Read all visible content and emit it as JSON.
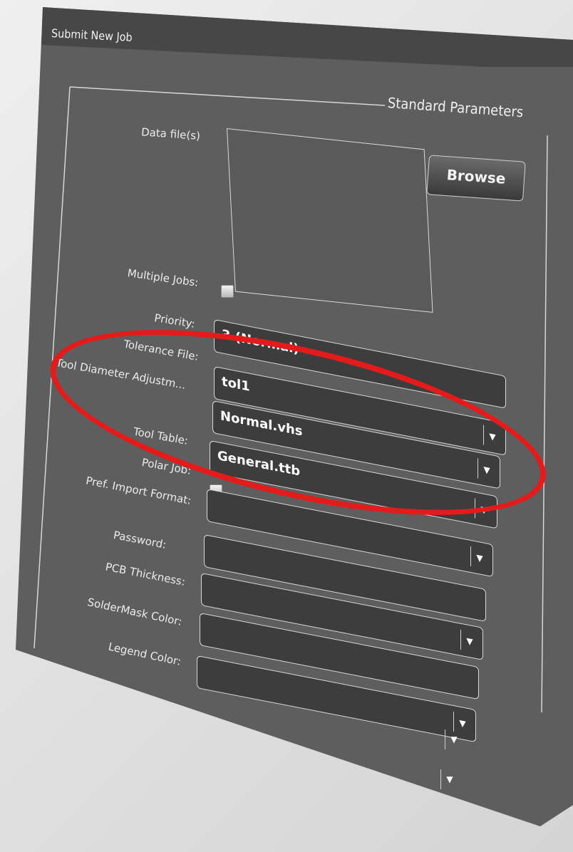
{
  "window": {
    "title": "Submit New Job"
  },
  "group": {
    "title": "Standard Parameters"
  },
  "data_files": {
    "label": "Data file(s)",
    "browse_label": "Browse"
  },
  "fields": {
    "multiple_jobs": {
      "label": "Multiple Jobs:"
    },
    "priority": {
      "label": "Priority:",
      "value": "3 (Normal)"
    },
    "tolerance_file": {
      "label": "Tolerance File:",
      "value": "tol1"
    },
    "tool_diameter": {
      "label": "Tool Diameter Adjustm...",
      "value": "Normal.vhs"
    },
    "tool_table": {
      "label": "Tool Table:",
      "value": "General.ttb"
    },
    "polar_job": {
      "label": "Polar Job:"
    },
    "pref_import_format": {
      "label": "Pref. Import Format:",
      "value": ""
    },
    "password": {
      "label": "Password:",
      "value": ""
    },
    "pcb_thickness": {
      "label": "PCB Thickness:",
      "value": ""
    },
    "soldermask_color": {
      "label": "SolderMask Color:",
      "value": ""
    },
    "legend_color": {
      "label": "Legend Color:",
      "value": ""
    }
  },
  "icons": {
    "dropdown": "chevron-down-icon"
  },
  "colors": {
    "highlight": "#e41b1b",
    "window": "#5e5e5e",
    "titlebar": "#474747"
  }
}
